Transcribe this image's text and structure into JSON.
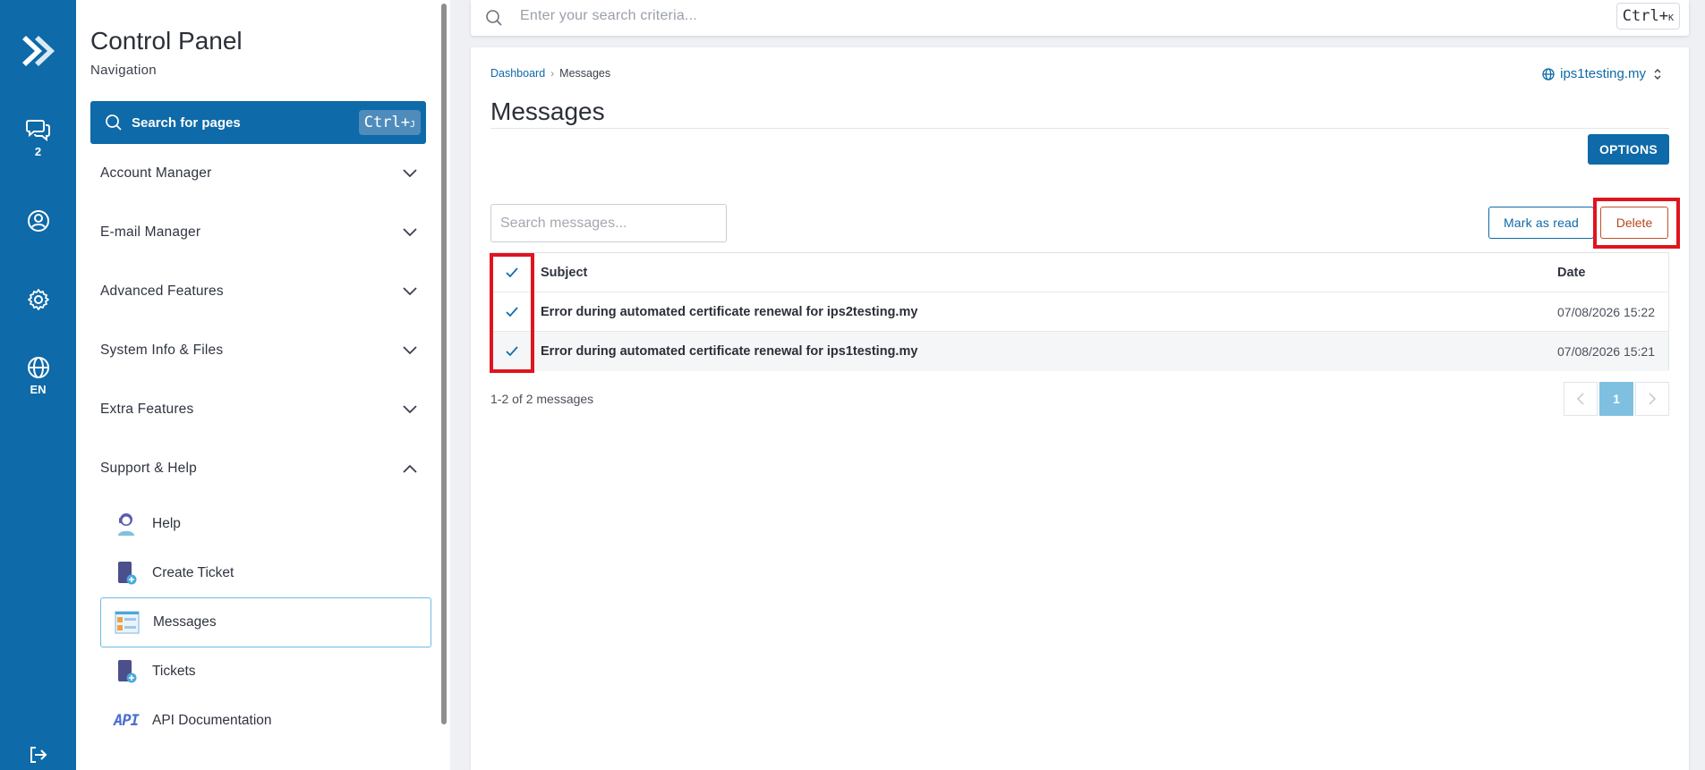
{
  "rail": {
    "chat_badge": "2",
    "lang_label": "EN"
  },
  "sidebar": {
    "title": "Control Panel",
    "subtitle": "Navigation",
    "search_label": "Search for pages",
    "search_kbd_main": "Ctrl+",
    "search_kbd_key": "J",
    "menu": [
      {
        "label": "Account Manager",
        "expanded": false
      },
      {
        "label": "E-mail Manager",
        "expanded": false
      },
      {
        "label": "Advanced Features",
        "expanded": false
      },
      {
        "label": "System Info & Files",
        "expanded": false
      },
      {
        "label": "Extra Features",
        "expanded": false
      },
      {
        "label": "Support & Help",
        "expanded": true
      }
    ],
    "support_items": [
      {
        "label": "Help",
        "icon": "help-agent-icon"
      },
      {
        "label": "Create Ticket",
        "icon": "create-ticket-icon"
      },
      {
        "label": "Messages",
        "icon": "messages-icon",
        "active": true
      },
      {
        "label": "Tickets",
        "icon": "tickets-icon"
      },
      {
        "label": "API Documentation",
        "icon": "api-icon",
        "icon_text": "API"
      }
    ]
  },
  "topbar": {
    "placeholder": "Enter your search criteria...",
    "kbd_main": "Ctrl+",
    "kbd_key": "K"
  },
  "breadcrumb": {
    "root": "Dashboard",
    "current": "Messages"
  },
  "domain_select": "ips1testing.my",
  "page_title": "Messages",
  "options_label": "OPTIONS",
  "messages": {
    "search_placeholder": "Search messages...",
    "mark_read_label": "Mark as read",
    "delete_label": "Delete",
    "columns": {
      "subject": "Subject",
      "date": "Date"
    },
    "rows": [
      {
        "subject": "Error during automated certificate renewal for ips2testing.my",
        "date": "07/08/2026 15:22",
        "checked": true
      },
      {
        "subject": "Error during automated certificate renewal for ips1testing.my",
        "date": "07/08/2026 15:21",
        "checked": true
      }
    ],
    "count_text": "1-2 of 2 messages",
    "current_page": "1"
  },
  "colors": {
    "brand": "#0e6aa8",
    "highlight": "#e0141e",
    "delete": "#b6461c"
  }
}
